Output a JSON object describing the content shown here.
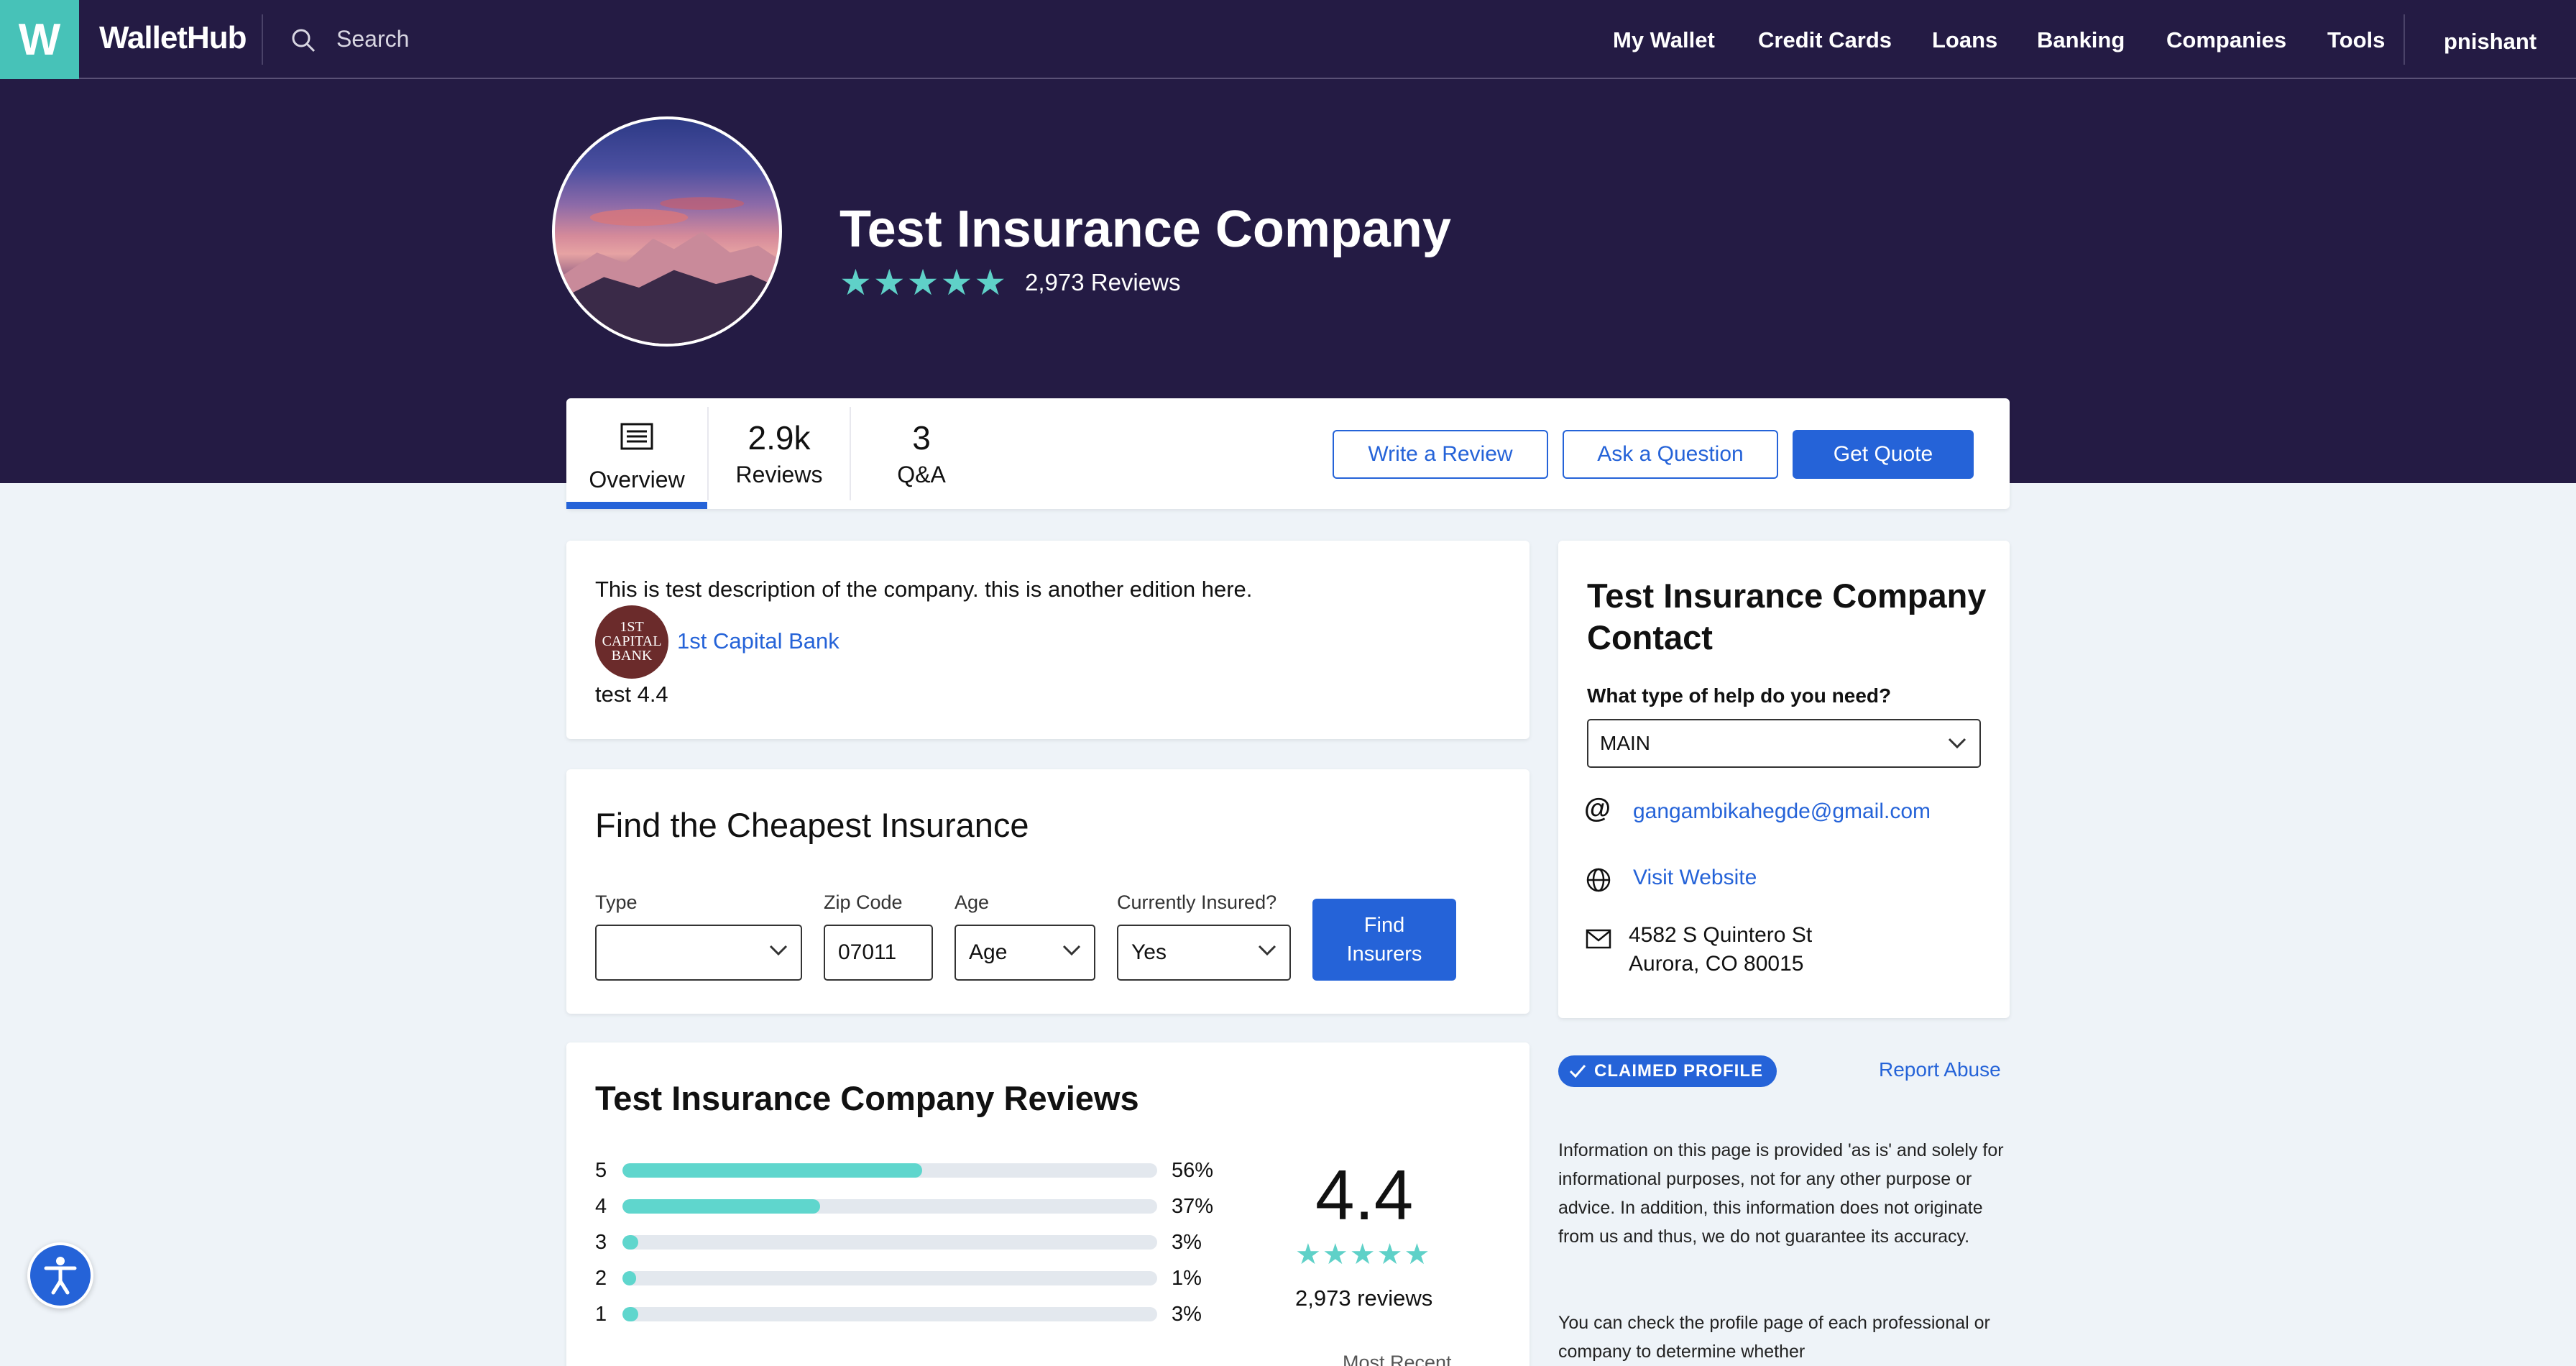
{
  "nav": {
    "logo_letter": "W",
    "brand": "WalletHub",
    "search_placeholder": "Search",
    "links": [
      "My Wallet",
      "Credit Cards",
      "Loans",
      "Banking",
      "Companies",
      "Tools"
    ],
    "user": "pnishant"
  },
  "hero": {
    "title": "Test Insurance Company",
    "stars": "★★★★★",
    "reviews": "2,973 Reviews"
  },
  "tabs": {
    "overview": "Overview",
    "reviews_count": "2.9k",
    "reviews_label": "Reviews",
    "qa_count": "3",
    "qa_label": "Q&A"
  },
  "actions": {
    "write_review": "Write a Review",
    "ask_question": "Ask a Question",
    "get_quote": "Get Quote"
  },
  "description": {
    "text": "This is test description of the company. this is another edition here.",
    "bank_logo_text": "1ST CAPITAL BANK",
    "bank_link": "1st Capital Bank",
    "test_line": "test 4.4"
  },
  "find": {
    "title": "Find the Cheapest Insurance",
    "type_label": "Type",
    "type_value": "",
    "zip_label": "Zip Code",
    "zip_value": "07011",
    "age_label": "Age",
    "age_value": "Age",
    "insured_label": "Currently Insured?",
    "insured_value": "Yes",
    "button": "Find Insurers"
  },
  "reviews_section": {
    "title": "Test Insurance Company Reviews",
    "rows": [
      {
        "stars": "5",
        "pct": "56%",
        "fill": 0.56
      },
      {
        "stars": "4",
        "pct": "37%",
        "fill": 0.37
      },
      {
        "stars": "3",
        "pct": "3%",
        "fill": 0.03
      },
      {
        "stars": "2",
        "pct": "1%",
        "fill": 0.01
      },
      {
        "stars": "1",
        "pct": "3%",
        "fill": 0.03
      }
    ],
    "score": "4.4",
    "stars": "★★★★★",
    "count": "2,973 reviews",
    "sort": "Most Recent"
  },
  "contact": {
    "title": "Test Insurance Company Contact",
    "help_question": "What type of help do you need?",
    "help_value": "MAIN",
    "email_symbol": "@",
    "email": "gangambikahegde@gmail.com",
    "website": "Visit Website",
    "address_line1": "4582 S Quintero St",
    "address_line2": "Aurora, CO 80015"
  },
  "sidebar": {
    "claimed": "CLAIMED PROFILE",
    "report": "Report Abuse",
    "info1": "Information on this page is provided 'as is' and solely for informational purposes, not for any other purpose or advice. In addition, this information does not originate from us and thus, we do not guarantee its accuracy.",
    "info2": "You can check the profile page of each professional or company to determine whether"
  },
  "colors": {
    "nav_bg": "#241b44",
    "accent_blue": "#2563d8",
    "teal": "#5fd1c8",
    "page_bg": "#eef3f8"
  },
  "icons": [
    "search-icon",
    "overview-list-icon",
    "chevron-down-icon",
    "globe-icon",
    "mail-icon",
    "check-icon",
    "accessibility-icon"
  ]
}
